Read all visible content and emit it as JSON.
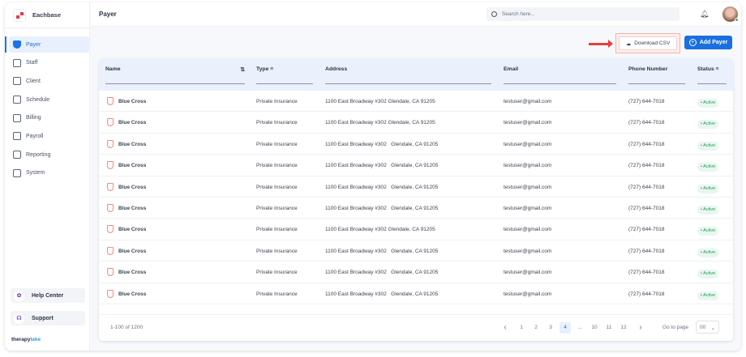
{
  "app": {
    "name": "Eachbase",
    "page_title": "Payer"
  },
  "sidebar": {
    "items": [
      {
        "label": "Payer",
        "icon": "shield-icon",
        "active": true
      },
      {
        "label": "Staff"
      },
      {
        "label": "Client"
      },
      {
        "label": "Schedule"
      },
      {
        "label": "Billing"
      },
      {
        "label": "Payroll"
      },
      {
        "label": "Reporting"
      },
      {
        "label": "System"
      }
    ],
    "help": "Help Center",
    "support": "Support",
    "footer_brand_a": "therapy",
    "footer_brand_b": "lake"
  },
  "header": {
    "search_placeholder": "Search here..."
  },
  "toolbar": {
    "download": "Download CSV",
    "add": "Add Payer"
  },
  "table": {
    "columns": [
      "Name",
      "Type",
      "Address",
      "Email",
      "Phone Number",
      "Status"
    ],
    "rows": [
      {
        "name": "Blue Cross",
        "type": "Private Insurance",
        "address": "1100 East Broadway #302 Glendale, CA 91205",
        "email": "testuser@gmail.com",
        "phone": "(727) 644-7018",
        "status": "Active"
      },
      {
        "name": "Blue Cross",
        "type": "Private Insurance",
        "address": "1100 East Broadway #302 Glendale, CA 91205",
        "email": "testuser@gmail.com",
        "phone": "(727) 644-7018",
        "status": "Active"
      },
      {
        "name": "Blue Cross",
        "type": "Private Insurance",
        "address": "1100 East Broadway #302   Glendale, CA 91205",
        "email": "testuser@gmail.com",
        "phone": "(727) 644-7018",
        "status": "Active"
      },
      {
        "name": "Blue Cross",
        "type": "Private Insurance",
        "address": "1100 East Broadway #302   Glendale, CA 91205",
        "email": "testuser@gmail.com",
        "phone": "(727) 644-7018",
        "status": "Active"
      },
      {
        "name": "Blue Cross",
        "type": "Private Insurance",
        "address": "1100 East Broadway #302   Glendale, CA 91205",
        "email": "testuser@gmail.com",
        "phone": "(727) 644-7018",
        "status": "Active"
      },
      {
        "name": "Blue Cross",
        "type": "Private Insurance",
        "address": "1100 East Broadway #302   Glendale, CA 91205",
        "email": "testuser@gmail.com",
        "phone": "(727) 644-7018",
        "status": "Active"
      },
      {
        "name": "Blue Cross",
        "type": "Private Insurance",
        "address": "1100 East Broadway #302 Glendale, CA 91205",
        "email": "testuser@gmail.com",
        "phone": "(727) 644-7018",
        "status": "Active"
      },
      {
        "name": "Blue Cross",
        "type": "Private Insurance",
        "address": "1100 East Broadway #302   Glendale, CA 91205",
        "email": "testuser@gmail.com",
        "phone": "(727) 644-7018",
        "status": "Active"
      },
      {
        "name": "Blue Cross",
        "type": "Private Insurance",
        "address": "1100 East Broadway #302   Glendale, CA 91205",
        "email": "testuser@gmail.com",
        "phone": "(727) 644-7018",
        "status": "Active"
      },
      {
        "name": "Blue Cross",
        "type": "Private Insurance",
        "address": "1100 East Broadway #302   Glendale, CA 91205",
        "email": "testuser@gmail.com",
        "phone": "(727) 644-7018",
        "status": "Active"
      }
    ]
  },
  "pagination": {
    "range": "1-100 of 1200",
    "pages": [
      "1",
      "2",
      "3",
      "4",
      "...",
      "10",
      "11",
      "12"
    ],
    "current": "4",
    "goto_label": "Go to page",
    "goto_value": "00"
  }
}
